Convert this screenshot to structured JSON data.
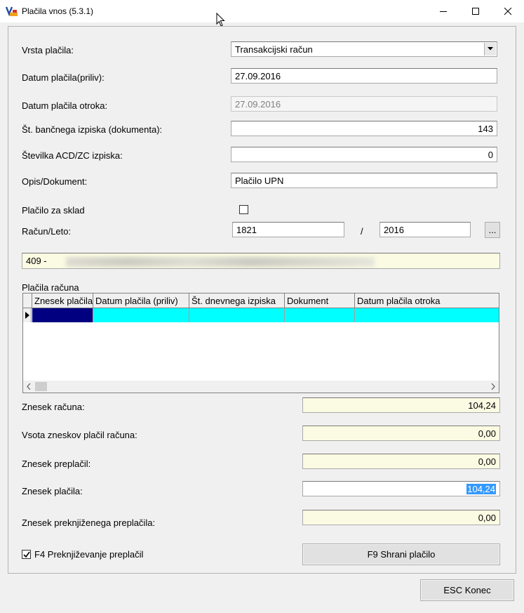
{
  "window": {
    "title": "Plačila vnos  (5.3.1)"
  },
  "form": {
    "vrsta_placila": {
      "label": "Vrsta plačila:",
      "value": "Transakcijski račun"
    },
    "datum_placila": {
      "label": "Datum plačila(priliv):",
      "value": "27.09.2016"
    },
    "datum_placila_otroka": {
      "label": "Datum plačila otroka:",
      "value": "27.09.2016"
    },
    "st_bancnega_izpiska": {
      "label": "Št. bančnega izpiska (dokumenta):",
      "value": "143"
    },
    "stevilka_acd": {
      "label": "Številka ACD/ZC izpiska:",
      "value": "0"
    },
    "opis_dokument": {
      "label": "Opis/Dokument:",
      "value": "Plačilo UPN"
    },
    "placilo_za_sklad": {
      "label": "Plačilo za sklad",
      "checked": false
    },
    "racun_leto": {
      "label": "Račun/Leto:",
      "racun": "1821",
      "separator": "/",
      "leto": "2016",
      "browse_label": "..."
    },
    "info_line": {
      "prefix": "409 -"
    }
  },
  "grid": {
    "title": "Plačila računa",
    "columns": [
      "Znesek plačila",
      "Datum plačila (priliv)",
      "Št. dnevnega izpiska",
      "Dokument",
      "Datum plačila otroka"
    ]
  },
  "totals": {
    "znesek_racuna": {
      "label": "Znesek računa:",
      "value": "104,24"
    },
    "vsota_zneskov": {
      "label": "Vsota zneskov plačil računa:",
      "value": "0,00"
    },
    "znesek_preplacil": {
      "label": "Znesek preplačil:",
      "value": "0,00"
    },
    "znesek_placila": {
      "label": "Znesek plačila:",
      "value": "104,24"
    },
    "znesek_preknjizenega": {
      "label": "Znesek preknjiženega preplačila:",
      "value": "0,00"
    }
  },
  "options": {
    "f4_preknjizevanje": {
      "label": "F4 Preknjiževanje preplačil",
      "checked": true
    }
  },
  "buttons": {
    "f9_shrani": "F9 Shrani plačilo",
    "esc_konec": "ESC Konec"
  },
  "colors": {
    "grid_selected_cell": "#000080",
    "grid_row": "#00ffff",
    "readonly_field": "#fbfbe3",
    "text_selection": "#3399ff"
  }
}
